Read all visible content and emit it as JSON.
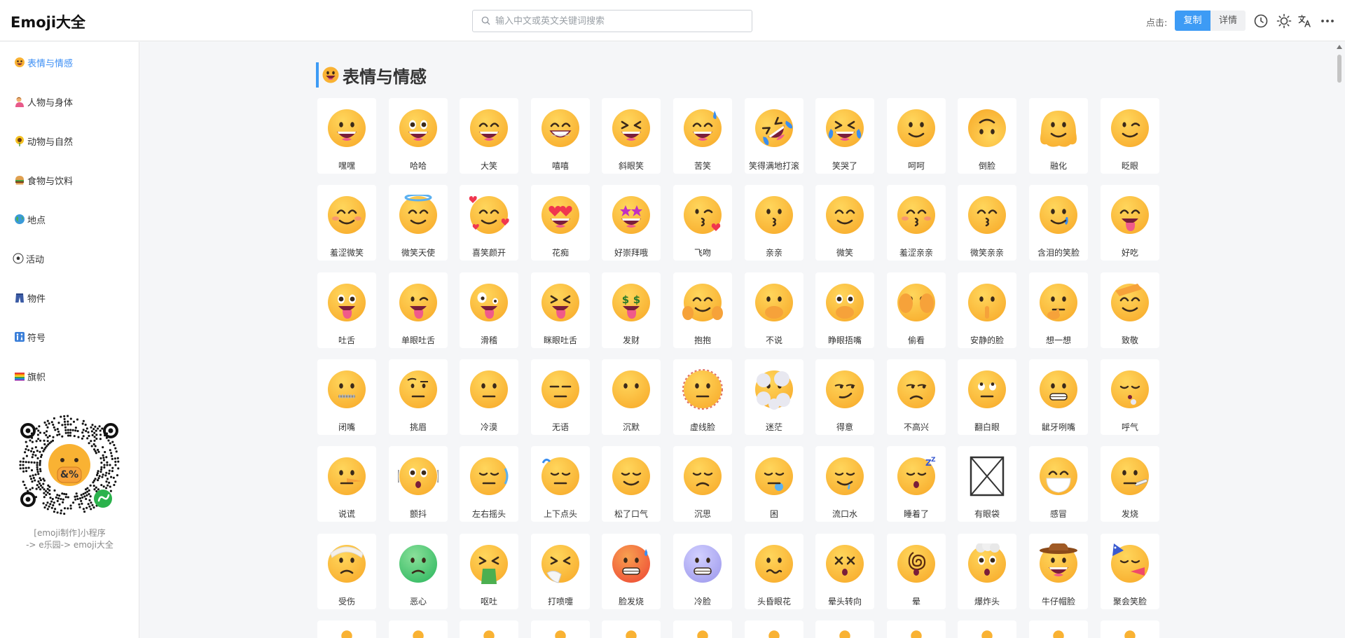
{
  "header": {
    "title": "Emoji大全",
    "search_placeholder": "输入中文或英文关键词搜索",
    "click_label": "点击:",
    "copy_label": "复制",
    "detail_label": "详情"
  },
  "sidebar": {
    "items": [
      {
        "label": "表情与情感",
        "icon": "grinning-face-icon",
        "color": "#f5b73d"
      },
      {
        "label": "人物与身体",
        "icon": "person-tipping-hand-icon",
        "color": "#e8a040"
      },
      {
        "label": "动物与自然",
        "icon": "sunflower-icon",
        "color": "#e8b020"
      },
      {
        "label": "食物与饮料",
        "icon": "hamburger-icon",
        "color": "#d08a3a"
      },
      {
        "label": "地点",
        "icon": "globe-icon",
        "color": "#3a9ad9"
      },
      {
        "label": "活动",
        "icon": "soccer-ball-icon",
        "color": "#333333"
      },
      {
        "label": "物件",
        "icon": "jeans-icon",
        "color": "#3b5ba5"
      },
      {
        "label": "符号",
        "icon": "restroom-sign-icon",
        "color": "#3b7fd9"
      },
      {
        "label": "旗帜",
        "icon": "rainbow-flag-icon",
        "color": "#9b59b6"
      }
    ],
    "qr_caption_line1": "[emoji制作]小程序",
    "qr_caption_line2": "-> e乐园-> emoji大全"
  },
  "section": {
    "title": "表情与情感"
  },
  "emojis": [
    {
      "label": "嘿嘿",
      "mouth": "open",
      "eyes": "dots"
    },
    {
      "label": "哈哈",
      "mouth": "open",
      "eyes": "big"
    },
    {
      "label": "大笑",
      "mouth": "open",
      "eyes": "happy"
    },
    {
      "label": "嘻嘻",
      "mouth": "teeth",
      "eyes": "happy"
    },
    {
      "label": "斜眼笑",
      "mouth": "open",
      "eyes": "squint"
    },
    {
      "label": "苦笑",
      "mouth": "open",
      "eyes": "happy",
      "extra": "sweat"
    },
    {
      "label": "笑得满地打滚",
      "mouth": "open",
      "eyes": "squint",
      "extra": "tears",
      "tilt": true
    },
    {
      "label": "笑哭了",
      "mouth": "open",
      "eyes": "squint",
      "extra": "tears"
    },
    {
      "label": "呵呵",
      "mouth": "smile",
      "eyes": "dots"
    },
    {
      "label": "倒脸",
      "mouth": "smile",
      "eyes": "dots",
      "flip": true
    },
    {
      "label": "融化",
      "mouth": "smile",
      "eyes": "dots",
      "extra": "melt"
    },
    {
      "label": "眨眼",
      "mouth": "smile",
      "eyes": "wink"
    },
    {
      "label": "羞涩微笑",
      "mouth": "smile",
      "eyes": "happy",
      "extra": "blush"
    },
    {
      "label": "微笑天使",
      "mouth": "smile",
      "eyes": "happy",
      "extra": "halo"
    },
    {
      "label": "喜笑颜开",
      "mouth": "smile",
      "eyes": "happy",
      "extra": "hearts"
    },
    {
      "label": "花痴",
      "mouth": "open",
      "eyes": "hearts"
    },
    {
      "label": "好崇拜哦",
      "mouth": "open",
      "eyes": "stars"
    },
    {
      "label": "飞吻",
      "mouth": "kiss",
      "eyes": "wink",
      "extra": "kissheart"
    },
    {
      "label": "亲亲",
      "mouth": "kiss",
      "eyes": "dots"
    },
    {
      "label": "微笑",
      "mouth": "smile",
      "eyes": "happy"
    },
    {
      "label": "羞涩亲亲",
      "mouth": "kiss",
      "eyes": "happy",
      "extra": "blush"
    },
    {
      "label": "微笑亲亲",
      "mouth": "kiss",
      "eyes": "happy"
    },
    {
      "label": "含泪的笑脸",
      "mouth": "smile",
      "eyes": "dots",
      "extra": "tear"
    },
    {
      "label": "好吃",
      "mouth": "tongue",
      "eyes": "happy"
    },
    {
      "label": "吐舌",
      "mouth": "tongue",
      "eyes": "big"
    },
    {
      "label": "单眼吐舌",
      "mouth": "tongue",
      "eyes": "wink"
    },
    {
      "label": "滑稽",
      "mouth": "tongue",
      "eyes": "zany"
    },
    {
      "label": "眯眼吐舌",
      "mouth": "tongue",
      "eyes": "squint"
    },
    {
      "label": "发财",
      "mouth": "tongue",
      "eyes": "money"
    },
    {
      "label": "抱抱",
      "mouth": "smile",
      "eyes": "happy",
      "extra": "hands"
    },
    {
      "label": "不说",
      "mouth": "none",
      "eyes": "dots",
      "extra": "handmouth"
    },
    {
      "label": "睁眼捂嘴",
      "mouth": "none",
      "eyes": "big",
      "extra": "handmouth"
    },
    {
      "label": "偷看",
      "mouth": "none",
      "eyes": "dots",
      "extra": "peek"
    },
    {
      "label": "安静的脸",
      "mouth": "none",
      "eyes": "dots",
      "extra": "finger"
    },
    {
      "label": "想一想",
      "mouth": "flat",
      "eyes": "dots",
      "extra": "think"
    },
    {
      "label": "致敬",
      "mouth": "smile",
      "eyes": "happy",
      "extra": "salute"
    },
    {
      "label": "闭嘴",
      "mouth": "zip",
      "eyes": "dots"
    },
    {
      "label": "挑眉",
      "mouth": "flat",
      "eyes": "brow"
    },
    {
      "label": "冷漠",
      "mouth": "flat",
      "eyes": "dots"
    },
    {
      "label": "无语",
      "mouth": "flat",
      "eyes": "lines"
    },
    {
      "label": "沉默",
      "mouth": "none",
      "eyes": "dots"
    },
    {
      "label": "虚线脸",
      "mouth": "flat",
      "eyes": "dots",
      "extra": "dotted"
    },
    {
      "label": "迷茫",
      "mouth": "none",
      "eyes": "dots",
      "extra": "clouds"
    },
    {
      "label": "得意",
      "mouth": "smirk",
      "eyes": "side"
    },
    {
      "label": "不高兴",
      "mouth": "frown",
      "eyes": "side"
    },
    {
      "label": "翻白眼",
      "mouth": "flat",
      "eyes": "roll"
    },
    {
      "label": "龇牙咧嘴",
      "mouth": "grimace",
      "eyes": "dots"
    },
    {
      "label": "呼气",
      "mouth": "puff",
      "eyes": "closed"
    },
    {
      "label": "说谎",
      "mouth": "flat",
      "eyes": "dots",
      "extra": "nose"
    },
    {
      "label": "颤抖",
      "mouth": "o",
      "eyes": "big",
      "extra": "shake"
    },
    {
      "label": "左右摇头",
      "mouth": "flat",
      "eyes": "closed",
      "extra": "shakeh"
    },
    {
      "label": "上下点头",
      "mouth": "flat",
      "eyes": "closed",
      "extra": "nod"
    },
    {
      "label": "松了口气",
      "mouth": "smile",
      "eyes": "closed"
    },
    {
      "label": "沉思",
      "mouth": "frown",
      "eyes": "closed"
    },
    {
      "label": "困",
      "mouth": "flat",
      "eyes": "closed",
      "extra": "bubble"
    },
    {
      "label": "流口水",
      "mouth": "drool",
      "eyes": "closed"
    },
    {
      "label": "睡着了",
      "mouth": "o",
      "eyes": "closed",
      "extra": "zzz"
    },
    {
      "label": "有眼袋",
      "missing": true
    },
    {
      "label": "感冒",
      "mouth": "none",
      "eyes": "happy",
      "extra": "mask"
    },
    {
      "label": "发烧",
      "mouth": "flat",
      "eyes": "dots",
      "extra": "thermo"
    },
    {
      "label": "受伤",
      "mouth": "frown",
      "eyes": "dots",
      "extra": "bandage"
    },
    {
      "label": "恶心",
      "mouth": "frown",
      "eyes": "dots",
      "extra": "green"
    },
    {
      "label": "呕吐",
      "mouth": "vomit",
      "eyes": "squint"
    },
    {
      "label": "打喷嚏",
      "mouth": "none",
      "eyes": "squint",
      "extra": "tissue"
    },
    {
      "label": "脸发烧",
      "mouth": "grimace",
      "eyes": "dots",
      "extra": "hot"
    },
    {
      "label": "冷脸",
      "mouth": "grimace",
      "eyes": "dots",
      "extra": "cold"
    },
    {
      "label": "头昏眼花",
      "mouth": "wavy",
      "eyes": "dots"
    },
    {
      "label": "晕头转向",
      "mouth": "o",
      "eyes": "x"
    },
    {
      "label": "晕",
      "mouth": "o",
      "eyes": "spiral"
    },
    {
      "label": "爆炸头",
      "mouth": "o",
      "eyes": "big",
      "extra": "explode"
    },
    {
      "label": "牛仔帽脸",
      "mouth": "open",
      "eyes": "dots",
      "extra": "hat"
    },
    {
      "label": "聚会笑脸",
      "mouth": "horn",
      "eyes": "closed",
      "extra": "party"
    },
    {
      "label": "",
      "partial": true
    },
    {
      "label": "",
      "partial": true
    },
    {
      "label": "",
      "partial": true
    },
    {
      "label": "",
      "partial": true
    },
    {
      "label": "",
      "partial": true
    },
    {
      "label": "",
      "partial": true
    },
    {
      "label": "",
      "partial": true
    },
    {
      "label": "",
      "partial": true
    },
    {
      "label": "",
      "partial": true
    },
    {
      "label": "",
      "partial": true
    },
    {
      "label": "",
      "partial": true
    },
    {
      "label": "",
      "partial": true
    }
  ],
  "colors": {
    "accent": "#3d9bf5",
    "face": "#f9b233",
    "face_light": "#ffd65c"
  }
}
